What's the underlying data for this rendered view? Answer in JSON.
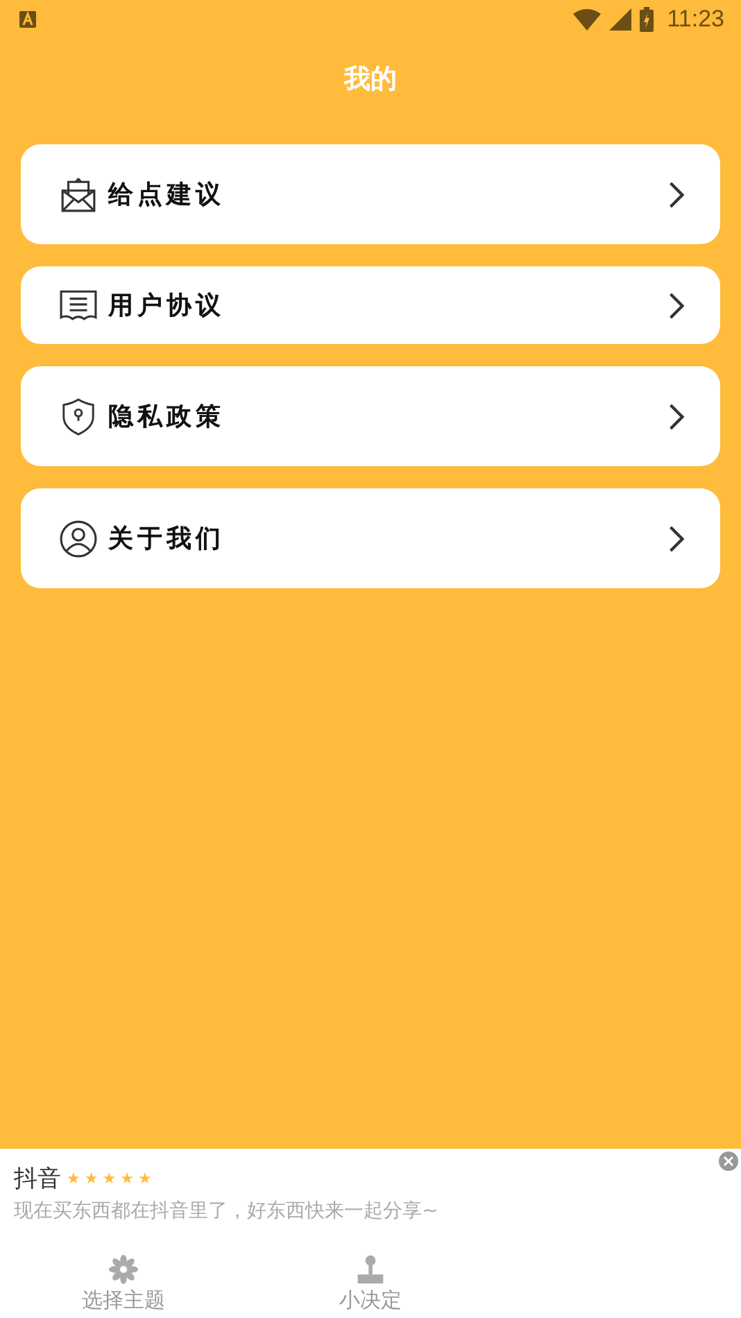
{
  "status_bar": {
    "time": "11:23"
  },
  "header": {
    "title": "我的"
  },
  "menu": [
    {
      "kind": "mail",
      "label": "给点建议"
    },
    {
      "kind": "document",
      "label": "用户协议"
    },
    {
      "kind": "shield",
      "label": "隐私政策"
    },
    {
      "kind": "person",
      "label": "关于我们"
    }
  ],
  "ad": {
    "title": "抖音",
    "stars": 5,
    "text": "现在买东西都在抖音里了，好东西快来一起分享~"
  },
  "bottom_nav": [
    {
      "kind": "flower",
      "label": "选择主题"
    },
    {
      "kind": "joystick",
      "label": "小决定"
    }
  ]
}
